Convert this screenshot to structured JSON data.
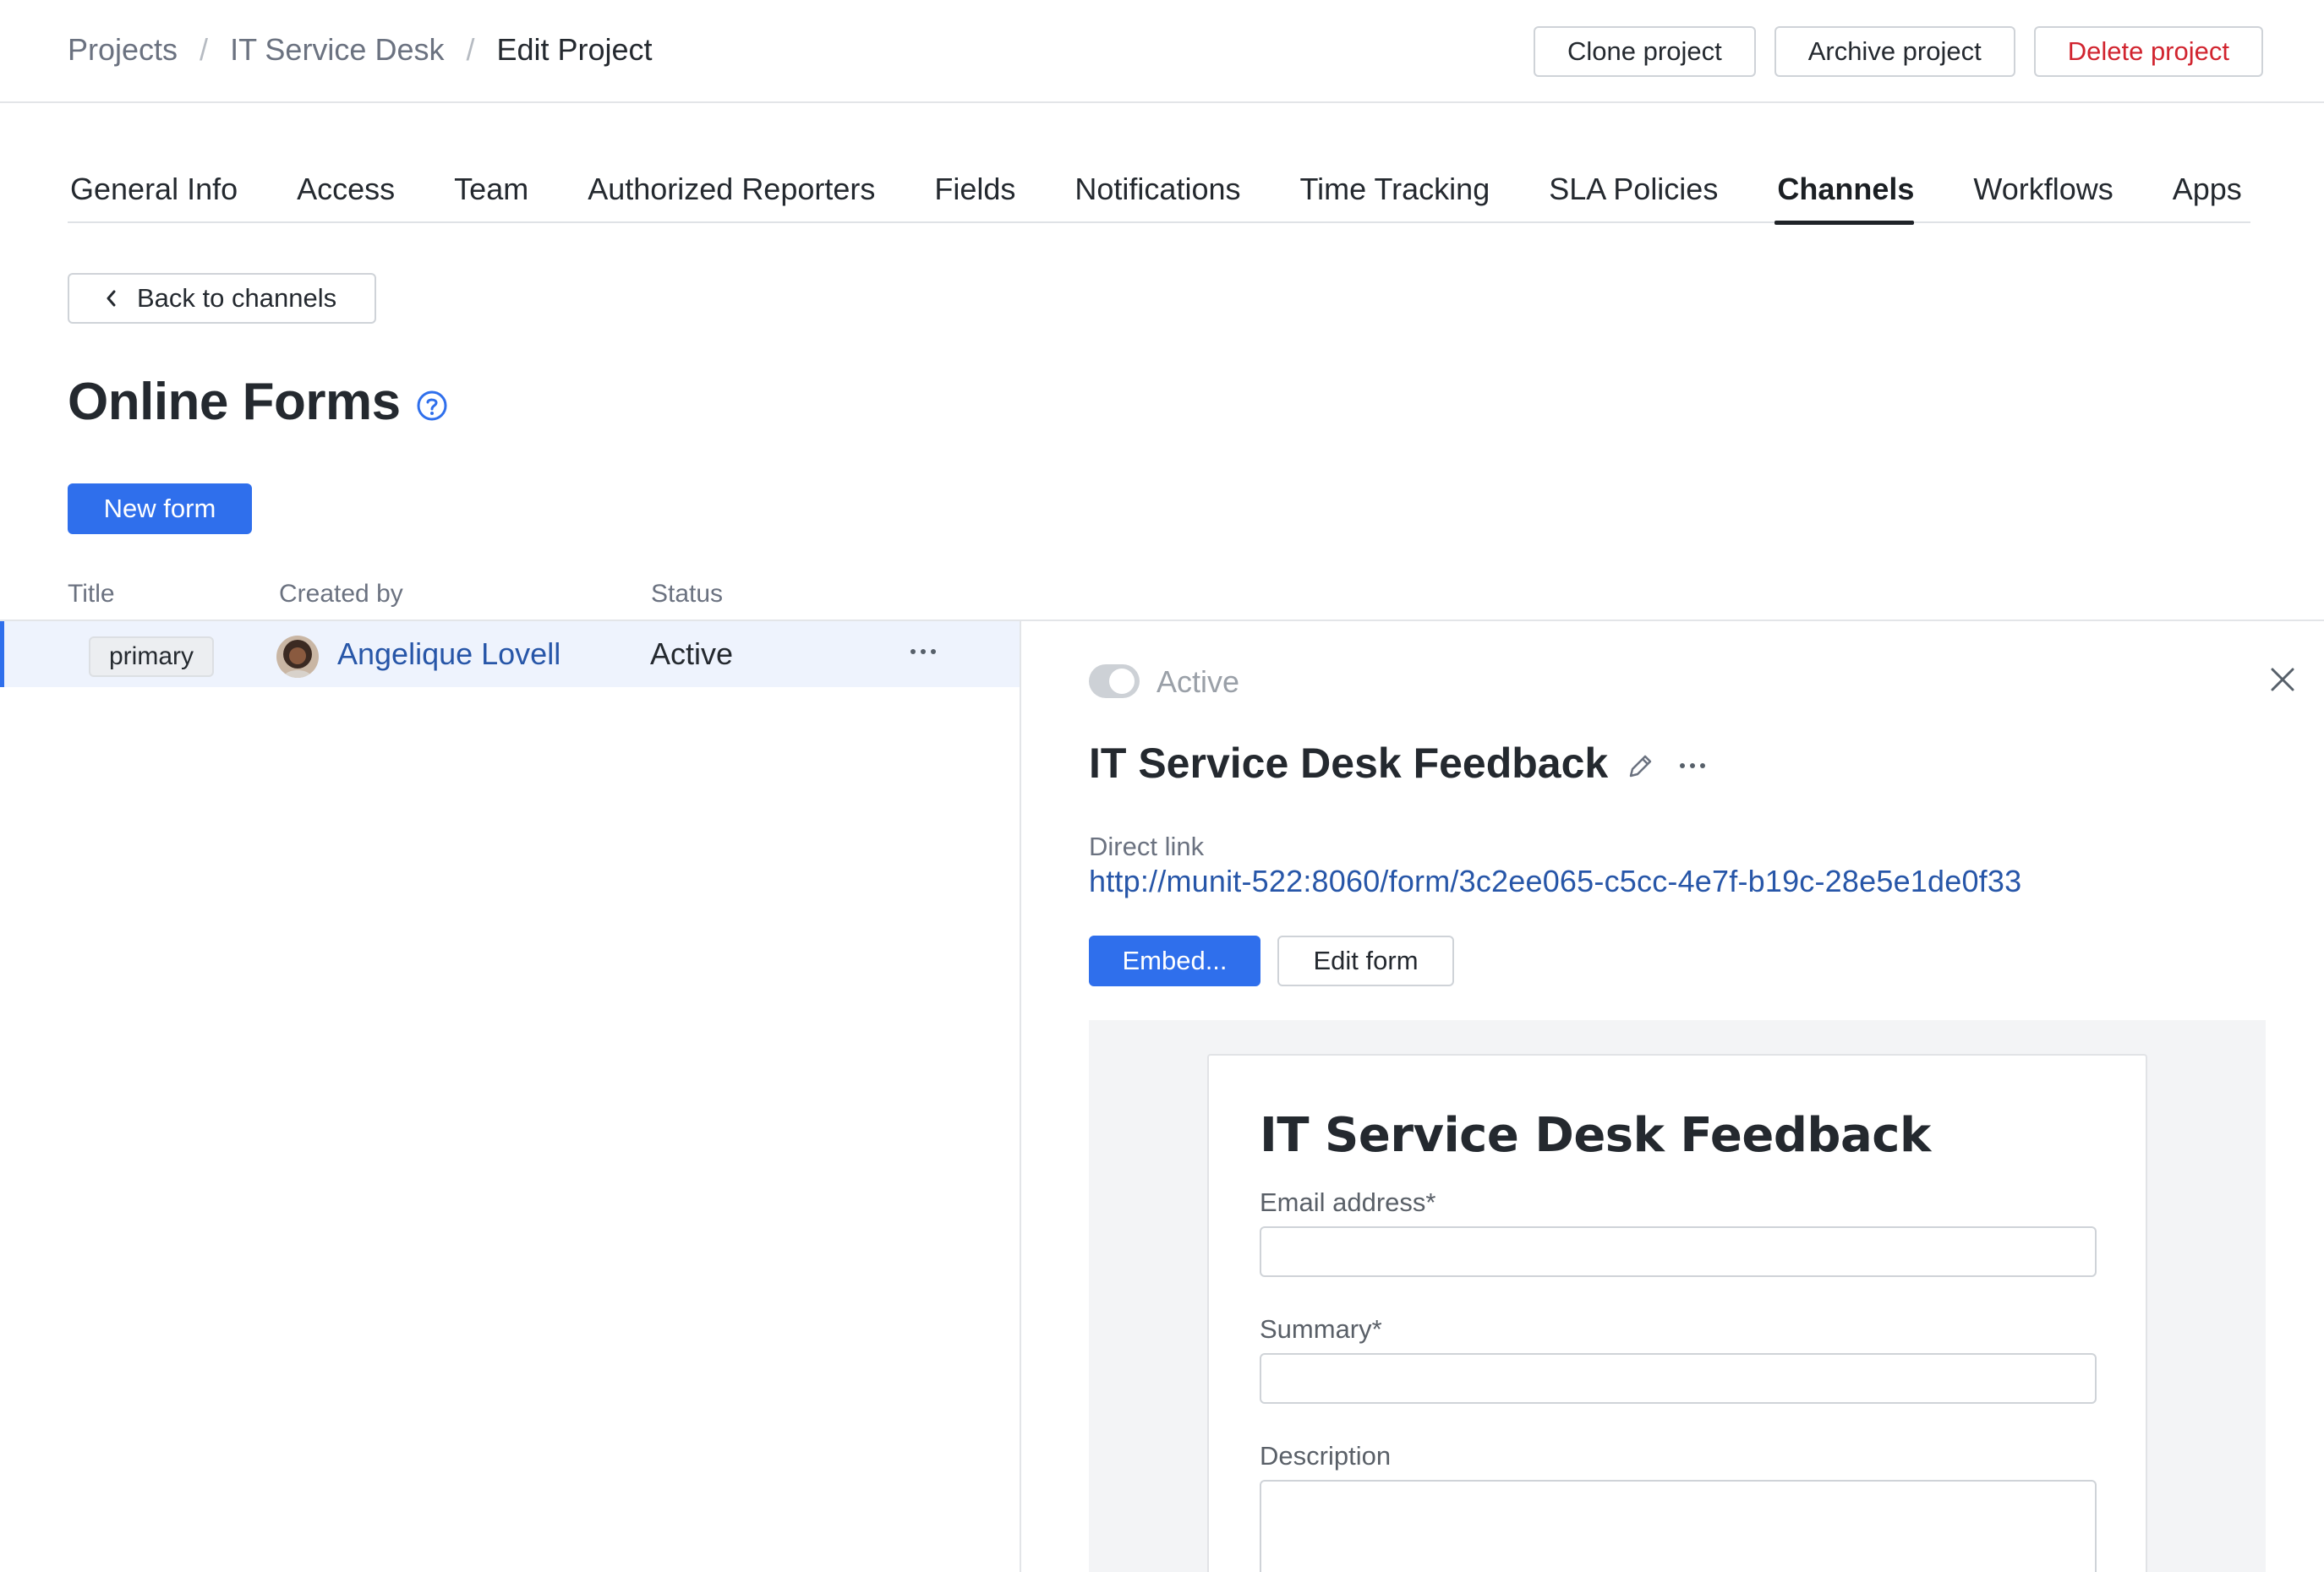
{
  "breadcrumb": {
    "items": [
      "Projects",
      "IT Service Desk",
      "Edit Project"
    ],
    "separator": "/"
  },
  "header_actions": {
    "clone": "Clone project",
    "archive": "Archive project",
    "delete": "Delete project"
  },
  "tabs": [
    {
      "label": "General Info",
      "active": false
    },
    {
      "label": "Access",
      "active": false
    },
    {
      "label": "Team",
      "active": false
    },
    {
      "label": "Authorized Reporters",
      "active": false
    },
    {
      "label": "Fields",
      "active": false
    },
    {
      "label": "Notifications",
      "active": false
    },
    {
      "label": "Time Tracking",
      "active": false
    },
    {
      "label": "SLA Policies",
      "active": false
    },
    {
      "label": "Channels",
      "active": true
    },
    {
      "label": "Workflows",
      "active": false
    },
    {
      "label": "Apps",
      "active": false
    }
  ],
  "back_button": {
    "label": "Back to channels",
    "icon": "chevron-left-icon"
  },
  "page": {
    "title": "Online Forms",
    "help_icon": "question-circle-icon"
  },
  "new_form_button": "New form",
  "table": {
    "columns": [
      "Title",
      "Created by",
      "Status"
    ],
    "rows": [
      {
        "title_tag": "primary",
        "created_by": "Angelique Lovell",
        "status": "Active",
        "selected": true
      }
    ]
  },
  "detail_panel": {
    "toggle_label": "Active",
    "toggle_enabled": true,
    "title": "IT Service Desk Feedback",
    "direct_link_label": "Direct link",
    "direct_link": "http://munit-522:8060/form/3c2ee065-c5cc-4e7f-b19c-28e5e1de0f33",
    "embed_button": "Embed...",
    "edit_form_button": "Edit form",
    "preview": {
      "title": "IT Service Desk Feedback",
      "fields": [
        {
          "label": "Email address*"
        },
        {
          "label": "Summary*"
        },
        {
          "label": "Description"
        }
      ]
    }
  },
  "colors": {
    "primary": "#2f6fec",
    "link": "#2756a8",
    "danger": "#d1242f",
    "selected_row_bg": "#eef3fd"
  }
}
